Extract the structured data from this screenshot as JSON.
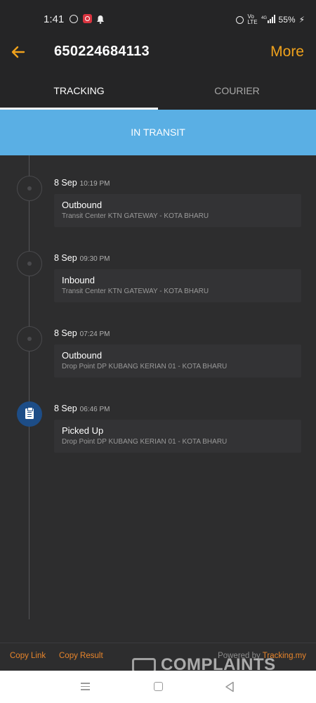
{
  "status_bar": {
    "time": "1:41",
    "network_top": "Vo",
    "network_bottom": "LTE",
    "signal_label": "4G",
    "battery": "55%",
    "icons": [
      "whatsapp-icon",
      "app-notification-icon",
      "bell-icon",
      "alarm-icon",
      "signal-icon",
      "charging-icon"
    ]
  },
  "app_bar": {
    "title": "650224684113",
    "more_label": "More",
    "back_icon": "arrow-left-icon",
    "accent_color": "#f0a21c"
  },
  "tabs": [
    {
      "label": "TRACKING",
      "selected": true
    },
    {
      "label": "COURIER",
      "selected": false
    }
  ],
  "status_banner": {
    "label": "IN TRANSIT",
    "color": "#5aafe4"
  },
  "events": [
    {
      "date": "8 Sep",
      "time": "10:19 PM",
      "title": "Outbound",
      "detail": "Transit Center KTN GATEWAY - KOTA BHARU",
      "icon": "dot-icon"
    },
    {
      "date": "8 Sep",
      "time": "09:30 PM",
      "title": "Inbound",
      "detail": "Transit Center KTN GATEWAY - KOTA BHARU",
      "icon": "dot-icon"
    },
    {
      "date": "8 Sep",
      "time": "07:24 PM",
      "title": "Outbound",
      "detail": "Drop Point DP KUBANG KERIAN 01 - KOTA BHARU",
      "icon": "dot-icon"
    },
    {
      "date": "8 Sep",
      "time": "06:46 PM",
      "title": "Picked Up",
      "detail": "Drop Point DP KUBANG KERIAN 01 - KOTA BHARU",
      "icon": "clipboard-icon"
    }
  ],
  "footer": {
    "copy_link": "Copy Link",
    "copy_result": "Copy Result",
    "powered_by": "Powered by",
    "powered_brand": "Tracking.my",
    "link_color": "#e8852b"
  },
  "watermark": {
    "text": "COMPLAINTS"
  },
  "nav_bar": {
    "icons": [
      "recents-icon",
      "home-icon",
      "back-icon"
    ]
  }
}
